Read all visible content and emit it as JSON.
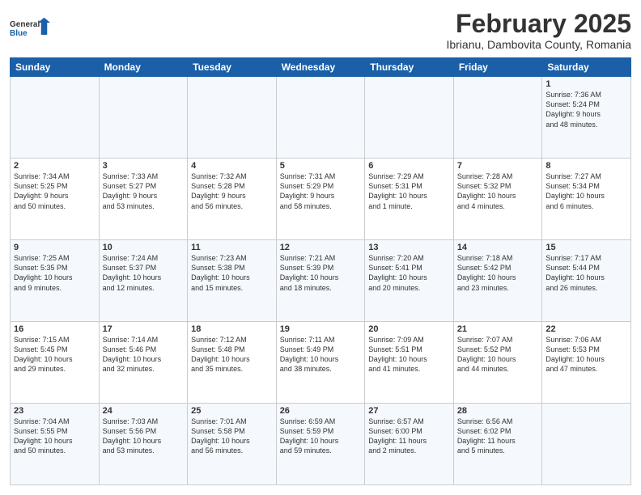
{
  "header": {
    "logo_general": "General",
    "logo_blue": "Blue",
    "month_year": "February 2025",
    "location": "Ibrianu, Dambovita County, Romania"
  },
  "days_of_week": [
    "Sunday",
    "Monday",
    "Tuesday",
    "Wednesday",
    "Thursday",
    "Friday",
    "Saturday"
  ],
  "weeks": [
    [
      {
        "day": "",
        "detail": ""
      },
      {
        "day": "",
        "detail": ""
      },
      {
        "day": "",
        "detail": ""
      },
      {
        "day": "",
        "detail": ""
      },
      {
        "day": "",
        "detail": ""
      },
      {
        "day": "",
        "detail": ""
      },
      {
        "day": "1",
        "detail": "Sunrise: 7:36 AM\nSunset: 5:24 PM\nDaylight: 9 hours\nand 48 minutes."
      }
    ],
    [
      {
        "day": "2",
        "detail": "Sunrise: 7:34 AM\nSunset: 5:25 PM\nDaylight: 9 hours\nand 50 minutes."
      },
      {
        "day": "3",
        "detail": "Sunrise: 7:33 AM\nSunset: 5:27 PM\nDaylight: 9 hours\nand 53 minutes."
      },
      {
        "day": "4",
        "detail": "Sunrise: 7:32 AM\nSunset: 5:28 PM\nDaylight: 9 hours\nand 56 minutes."
      },
      {
        "day": "5",
        "detail": "Sunrise: 7:31 AM\nSunset: 5:29 PM\nDaylight: 9 hours\nand 58 minutes."
      },
      {
        "day": "6",
        "detail": "Sunrise: 7:29 AM\nSunset: 5:31 PM\nDaylight: 10 hours\nand 1 minute."
      },
      {
        "day": "7",
        "detail": "Sunrise: 7:28 AM\nSunset: 5:32 PM\nDaylight: 10 hours\nand 4 minutes."
      },
      {
        "day": "8",
        "detail": "Sunrise: 7:27 AM\nSunset: 5:34 PM\nDaylight: 10 hours\nand 6 minutes."
      }
    ],
    [
      {
        "day": "9",
        "detail": "Sunrise: 7:25 AM\nSunset: 5:35 PM\nDaylight: 10 hours\nand 9 minutes."
      },
      {
        "day": "10",
        "detail": "Sunrise: 7:24 AM\nSunset: 5:37 PM\nDaylight: 10 hours\nand 12 minutes."
      },
      {
        "day": "11",
        "detail": "Sunrise: 7:23 AM\nSunset: 5:38 PM\nDaylight: 10 hours\nand 15 minutes."
      },
      {
        "day": "12",
        "detail": "Sunrise: 7:21 AM\nSunset: 5:39 PM\nDaylight: 10 hours\nand 18 minutes."
      },
      {
        "day": "13",
        "detail": "Sunrise: 7:20 AM\nSunset: 5:41 PM\nDaylight: 10 hours\nand 20 minutes."
      },
      {
        "day": "14",
        "detail": "Sunrise: 7:18 AM\nSunset: 5:42 PM\nDaylight: 10 hours\nand 23 minutes."
      },
      {
        "day": "15",
        "detail": "Sunrise: 7:17 AM\nSunset: 5:44 PM\nDaylight: 10 hours\nand 26 minutes."
      }
    ],
    [
      {
        "day": "16",
        "detail": "Sunrise: 7:15 AM\nSunset: 5:45 PM\nDaylight: 10 hours\nand 29 minutes."
      },
      {
        "day": "17",
        "detail": "Sunrise: 7:14 AM\nSunset: 5:46 PM\nDaylight: 10 hours\nand 32 minutes."
      },
      {
        "day": "18",
        "detail": "Sunrise: 7:12 AM\nSunset: 5:48 PM\nDaylight: 10 hours\nand 35 minutes."
      },
      {
        "day": "19",
        "detail": "Sunrise: 7:11 AM\nSunset: 5:49 PM\nDaylight: 10 hours\nand 38 minutes."
      },
      {
        "day": "20",
        "detail": "Sunrise: 7:09 AM\nSunset: 5:51 PM\nDaylight: 10 hours\nand 41 minutes."
      },
      {
        "day": "21",
        "detail": "Sunrise: 7:07 AM\nSunset: 5:52 PM\nDaylight: 10 hours\nand 44 minutes."
      },
      {
        "day": "22",
        "detail": "Sunrise: 7:06 AM\nSunset: 5:53 PM\nDaylight: 10 hours\nand 47 minutes."
      }
    ],
    [
      {
        "day": "23",
        "detail": "Sunrise: 7:04 AM\nSunset: 5:55 PM\nDaylight: 10 hours\nand 50 minutes."
      },
      {
        "day": "24",
        "detail": "Sunrise: 7:03 AM\nSunset: 5:56 PM\nDaylight: 10 hours\nand 53 minutes."
      },
      {
        "day": "25",
        "detail": "Sunrise: 7:01 AM\nSunset: 5:58 PM\nDaylight: 10 hours\nand 56 minutes."
      },
      {
        "day": "26",
        "detail": "Sunrise: 6:59 AM\nSunset: 5:59 PM\nDaylight: 10 hours\nand 59 minutes."
      },
      {
        "day": "27",
        "detail": "Sunrise: 6:57 AM\nSunset: 6:00 PM\nDaylight: 11 hours\nand 2 minutes."
      },
      {
        "day": "28",
        "detail": "Sunrise: 6:56 AM\nSunset: 6:02 PM\nDaylight: 11 hours\nand 5 minutes."
      },
      {
        "day": "",
        "detail": ""
      }
    ]
  ]
}
